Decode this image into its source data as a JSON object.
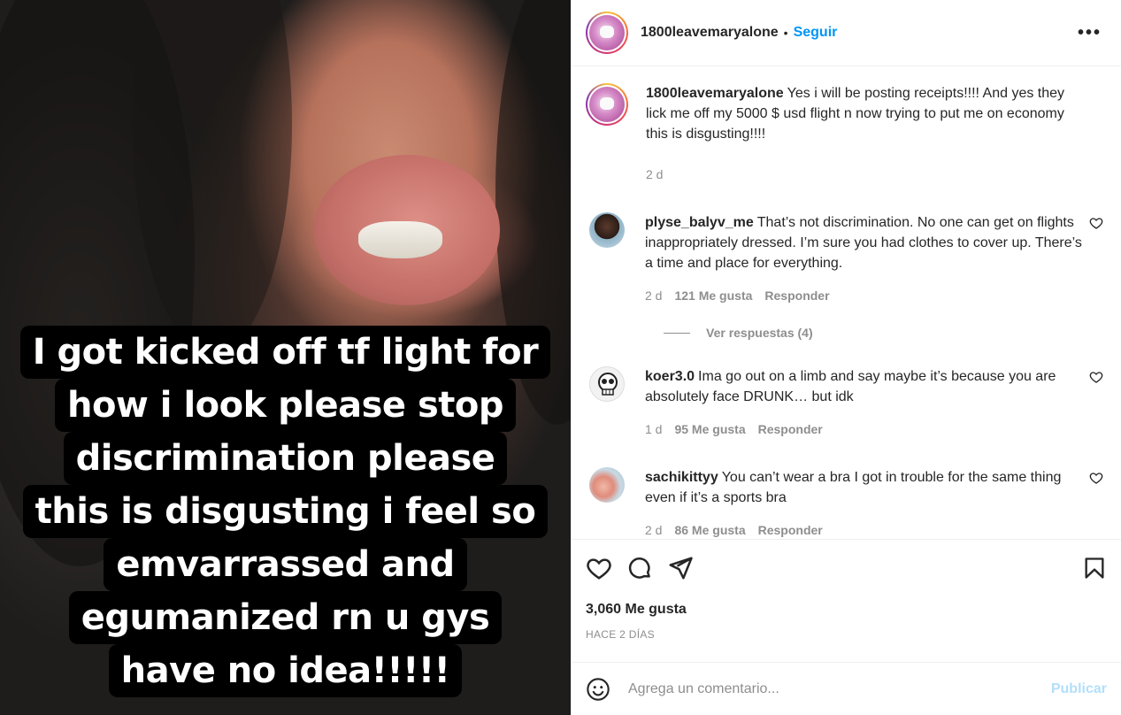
{
  "post": {
    "caption_lines": [
      "I got kicked off tf light for",
      "how i look please stop",
      "discrimination please",
      "this is disgusting i feel so",
      "emvarrassed and",
      "egumanized rn u gys",
      "have no idea!!!!!"
    ]
  },
  "header": {
    "username": "1800leavemaryalone",
    "separator": "•",
    "follow_label": "Seguir",
    "more_label": "•••"
  },
  "caption_comment": {
    "username": "1800leavemaryalone",
    "text": "Yes i will be posting receipts!!!! And yes they lick me off my 5000 $ usd flight n now trying to put me on economy this is disgusting!!!!",
    "time": "2 d"
  },
  "comments": [
    {
      "username": "plyse_balyv_me",
      "text": "That’s not discrimination. No one can get on flights inappropriately dressed. I’m sure you had clothes to cover up. There’s a time and place for everything.",
      "time": "2 d",
      "likes": "121 Me gusta",
      "reply": "Responder",
      "view_replies": "Ver respuestas (4)"
    },
    {
      "username": "koer3.0",
      "text": "Ima go out on a limb and say maybe it’s because you are absolutely face DRUNK… but idk",
      "time": "1 d",
      "likes": "95 Me gusta",
      "reply": "Responder"
    },
    {
      "username": "sachikittyy",
      "text": "You can’t wear a bra I got in trouble for the same thing even if it’s a sports bra",
      "time": "2 d",
      "likes": "86 Me gusta",
      "reply": "Responder"
    }
  ],
  "actions": {
    "likes_count": "3,060 Me gusta",
    "posted_time": "HACE 2 DÍAS"
  },
  "add_comment": {
    "placeholder": "Agrega un comentario...",
    "publish_label": "Publicar"
  },
  "colors": {
    "accent": "#0095f6",
    "publish_disabled": "#b2dffc",
    "secondary_text": "#8e8e8e",
    "primary_text": "#262626"
  },
  "icons": [
    "heart-icon",
    "comment-icon",
    "share-icon",
    "bookmark-icon",
    "emoji-icon",
    "more-options-icon"
  ]
}
